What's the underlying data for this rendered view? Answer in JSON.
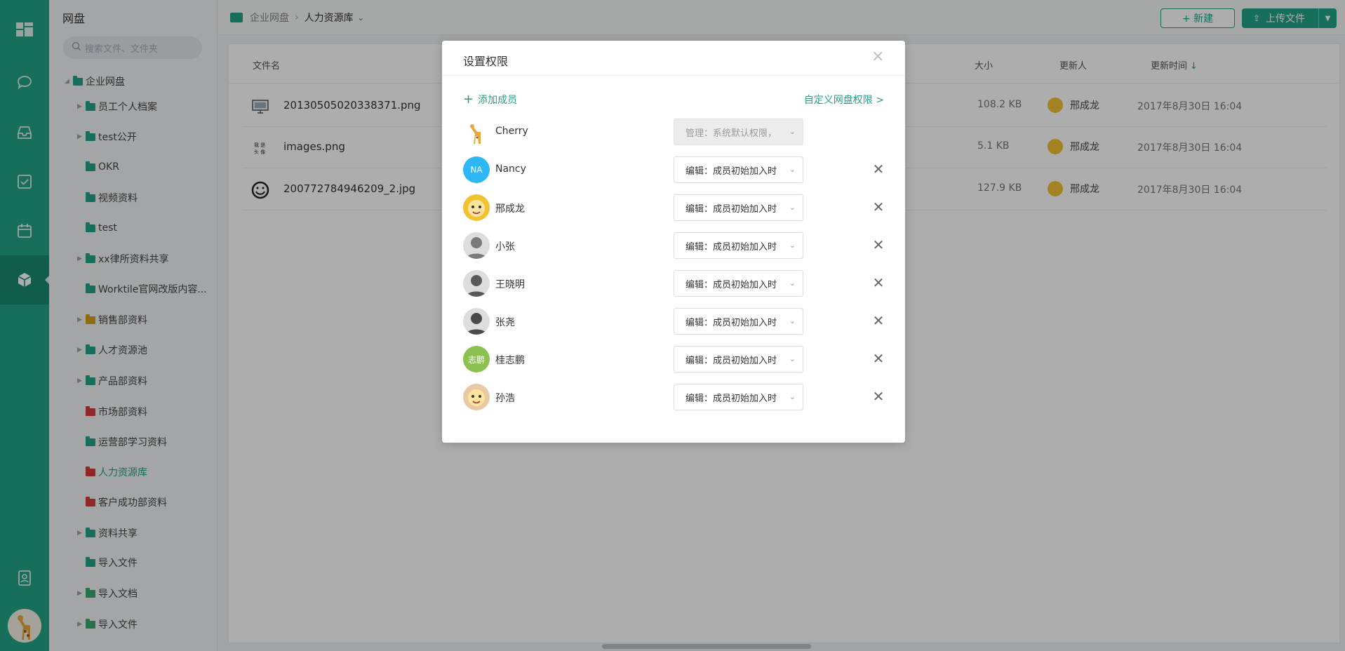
{
  "colors": {
    "accent": "#22a286",
    "rail": "#22a286",
    "overlay": "rgba(0,0,0,0.32)"
  },
  "sidebar": {
    "title": "网盘",
    "search_placeholder": "搜索文件、文件夹",
    "tree": [
      {
        "label": "企业网盘",
        "level": 0,
        "icon": "folder-icon",
        "color": "#22a286",
        "expanded": true
      },
      {
        "label": "员工个人档案",
        "level": 1,
        "icon": "folder-icon",
        "color": "#22a286",
        "collapsible": true
      },
      {
        "label": "test公开",
        "level": 1,
        "icon": "folder-icon",
        "color": "#22a286",
        "collapsible": true
      },
      {
        "label": "OKR",
        "level": 1,
        "icon": "folder-icon",
        "color": "#22a286"
      },
      {
        "label": "视频资料",
        "level": 1,
        "icon": "folder-icon",
        "color": "#22a286"
      },
      {
        "label": "test",
        "level": 1,
        "icon": "folder-icon",
        "color": "#22a286"
      },
      {
        "label": "xx律所资料共享",
        "level": 1,
        "icon": "folder-icon",
        "color": "#22a286",
        "collapsible": true
      },
      {
        "label": "Worktile官网改版内容...",
        "level": 1,
        "icon": "folder-icon",
        "color": "#22a286"
      },
      {
        "label": "销售部资料",
        "level": 1,
        "icon": "folder-icon",
        "color": "#d4a017",
        "collapsible": true
      },
      {
        "label": "人才资源池",
        "level": 1,
        "icon": "folder-icon",
        "color": "#22a286",
        "collapsible": true
      },
      {
        "label": "产品部资料",
        "level": 1,
        "icon": "folder-icon",
        "color": "#22a286",
        "collapsible": true
      },
      {
        "label": "市场部资料",
        "level": 1,
        "icon": "folder-icon",
        "color": "#d6393d"
      },
      {
        "label": "运营部学习资料",
        "level": 1,
        "icon": "folder-icon",
        "color": "#22a286"
      },
      {
        "label": "人力资源库",
        "level": 1,
        "icon": "folder-icon",
        "color": "#d6393d",
        "active": true
      },
      {
        "label": "客户成功部资料",
        "level": 1,
        "icon": "folder-icon",
        "color": "#d6393d"
      },
      {
        "label": "资料共享",
        "level": 1,
        "icon": "folder-icon",
        "color": "#22a286",
        "collapsible": true
      },
      {
        "label": "导入文件",
        "level": 1,
        "icon": "folder-icon",
        "color": "#22a286"
      },
      {
        "label": "导入文档",
        "level": 1,
        "icon": "folder-icon",
        "color": "#3aa86b",
        "collapsible": true
      },
      {
        "label": "导入文件",
        "level": 1,
        "icon": "folder-icon",
        "color": "#3aa86b",
        "collapsible": true
      }
    ]
  },
  "topbar": {
    "crumb_root": "企业网盘",
    "crumb_current": "人力资源库",
    "new_label": "+ 新建",
    "upload_label": "上传文件"
  },
  "table": {
    "col_name": "文件名",
    "col_size": "大小",
    "col_user": "更新人",
    "col_time": "更新时间",
    "files": [
      {
        "name": "20130505020338371.png",
        "size": "108.2 KB",
        "user": "邢成龙",
        "time": "2017年8月30日 16:04",
        "icon": "monitor-thumbnail-icon"
      },
      {
        "name": "images.png",
        "size": "5.1 KB",
        "user": "邢成龙",
        "time": "2017年8月30日 16:04",
        "icon": "avatar-text-thumbnail-icon"
      },
      {
        "name": "200772784946209_2.jpg",
        "size": "127.9 KB",
        "user": "邢成龙",
        "time": "2017年8月30日 16:04",
        "icon": "smiley-thumbnail-icon"
      }
    ]
  },
  "modal": {
    "title": "设置权限",
    "add_member": "添加成员",
    "custom_link": "自定义网盘权限 >",
    "members": [
      {
        "name": "Cherry",
        "permission": "管理：系统默认权限，",
        "avatar": "giraffe",
        "disabled": true
      },
      {
        "name": "Nancy",
        "permission": "编辑：成员初始加入时",
        "avatar": "NA",
        "avatar_color": "#2db7f5"
      },
      {
        "name": "邢成龙",
        "permission": "编辑：成员初始加入时",
        "avatar": "cartoon",
        "avatar_color": "#f1c232"
      },
      {
        "name": "小张",
        "permission": "编辑：成员初始加入时",
        "avatar": "photo",
        "avatar_color": "#7a7a7a"
      },
      {
        "name": "王晓明",
        "permission": "编辑：成员初始加入时",
        "avatar": "photo",
        "avatar_color": "#5a5a5a"
      },
      {
        "name": "张尧",
        "permission": "编辑：成员初始加入时",
        "avatar": "photo",
        "avatar_color": "#4a4a4a"
      },
      {
        "name": "桂志鹏",
        "permission": "编辑：成员初始加入时",
        "avatar": "志鹏",
        "avatar_color": "#8cc152"
      },
      {
        "name": "孙浩",
        "permission": "编辑：成员初始加入时",
        "avatar": "cartoon",
        "avatar_color": "#e9c9a3"
      }
    ]
  }
}
